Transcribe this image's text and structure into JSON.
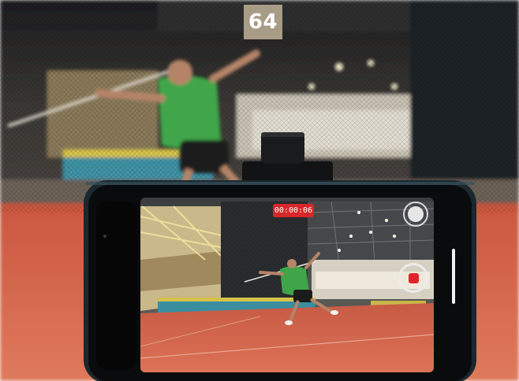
{
  "page": {
    "number": "64"
  },
  "camera_app": {
    "record_timer": "00:00:06",
    "record_state": "recording"
  },
  "scene": {
    "colors": {
      "track_orange": "#d86a4a",
      "hall_wall": "#2a2a2a",
      "phone_frame": "#1b2a33",
      "athlete_shirt": "#41a64a",
      "badge": "#a99c86",
      "record_red": "#d8262a"
    }
  }
}
